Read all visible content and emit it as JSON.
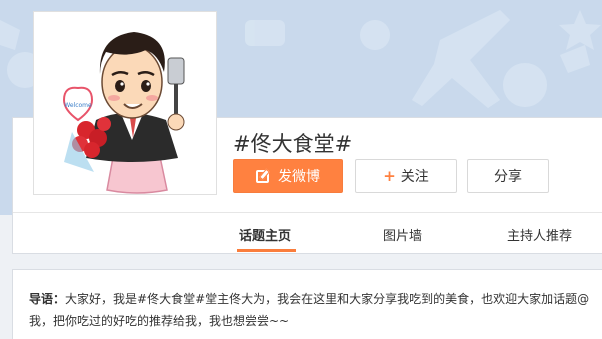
{
  "topic": {
    "title": "#佟大食堂#"
  },
  "actions": {
    "post_label": "发微博",
    "follow_label": "关注",
    "share_label": "分享"
  },
  "tabs": [
    {
      "label": "话题主页",
      "active": true
    },
    {
      "label": "图片墙",
      "active": false
    },
    {
      "label": "主持人推荐",
      "active": false
    }
  ],
  "intro": {
    "label": "导语：",
    "text": "大家好，我是#佟大食堂#堂主佟大为，我会在这里和大家分享我吃到的美食，也欢迎大家加话题@我，把你吃过的好吃的推荐给我，我也想尝尝~~"
  },
  "colors": {
    "accent": "#ff8140",
    "banner": "#c9d9ec",
    "page_bg": "#eef1f5"
  },
  "avatar": {
    "sign_text": "Welcome"
  }
}
